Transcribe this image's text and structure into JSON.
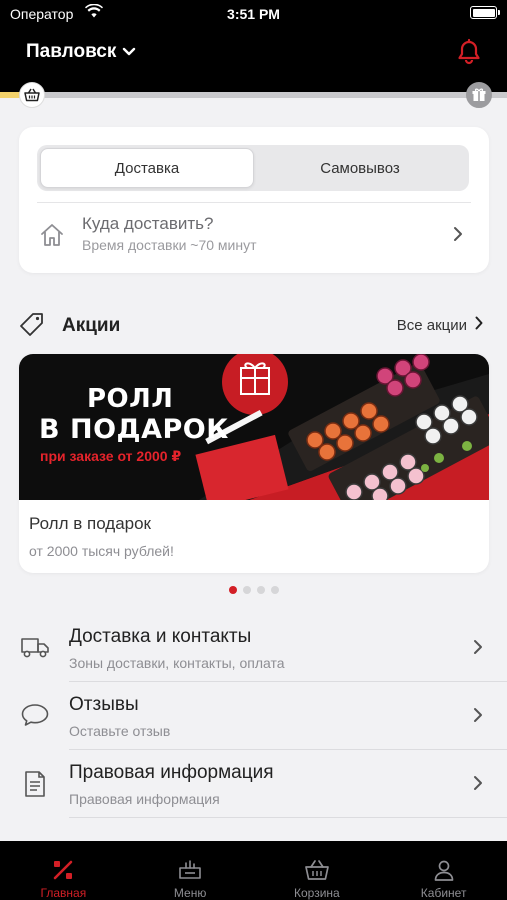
{
  "status_bar": {
    "carrier": "Оператор",
    "time": "3:51 PM"
  },
  "header": {
    "city": "Павловск"
  },
  "progress": {
    "fraction": 0.06
  },
  "delivery": {
    "tabs": [
      {
        "label": "Доставка",
        "active": true
      },
      {
        "label": "Самовывоз",
        "active": false
      }
    ],
    "address_title": "Куда доставить?",
    "address_subtitle": "Время доставки ~70 минут"
  },
  "promos": {
    "title": "Акции",
    "all_link": "Все акции",
    "card": {
      "banner_line1": "РОЛЛ",
      "banner_line2": "В ПОДАРОК",
      "banner_line3": "при заказе от 2000 ₽",
      "name": "Ролл в подарок",
      "description": "от 2000 тысяч рублей!"
    },
    "page_count": 4,
    "active_page": 1
  },
  "info": [
    {
      "title": "Доставка и контакты",
      "subtitle": "Зоны доставки, контакты, оплата",
      "icon": "truck-icon"
    },
    {
      "title": "Отзывы",
      "subtitle": "Оставьте отзыв",
      "icon": "speech-bubble-icon"
    },
    {
      "title": "Правовая информация",
      "subtitle": "Правовая информация",
      "icon": "document-icon"
    }
  ],
  "tabbar": [
    {
      "label": "Главная",
      "icon": "percent-icon",
      "active": true
    },
    {
      "label": "Меню",
      "icon": "menu-dish-icon",
      "active": false
    },
    {
      "label": "Корзина",
      "icon": "basket-icon",
      "active": false
    },
    {
      "label": "Кабинет",
      "icon": "person-icon",
      "active": false
    }
  ],
  "colors": {
    "accent": "#d31f26",
    "background": "#f2f2f4",
    "header": "#000000",
    "progress": "#f3d26b"
  }
}
